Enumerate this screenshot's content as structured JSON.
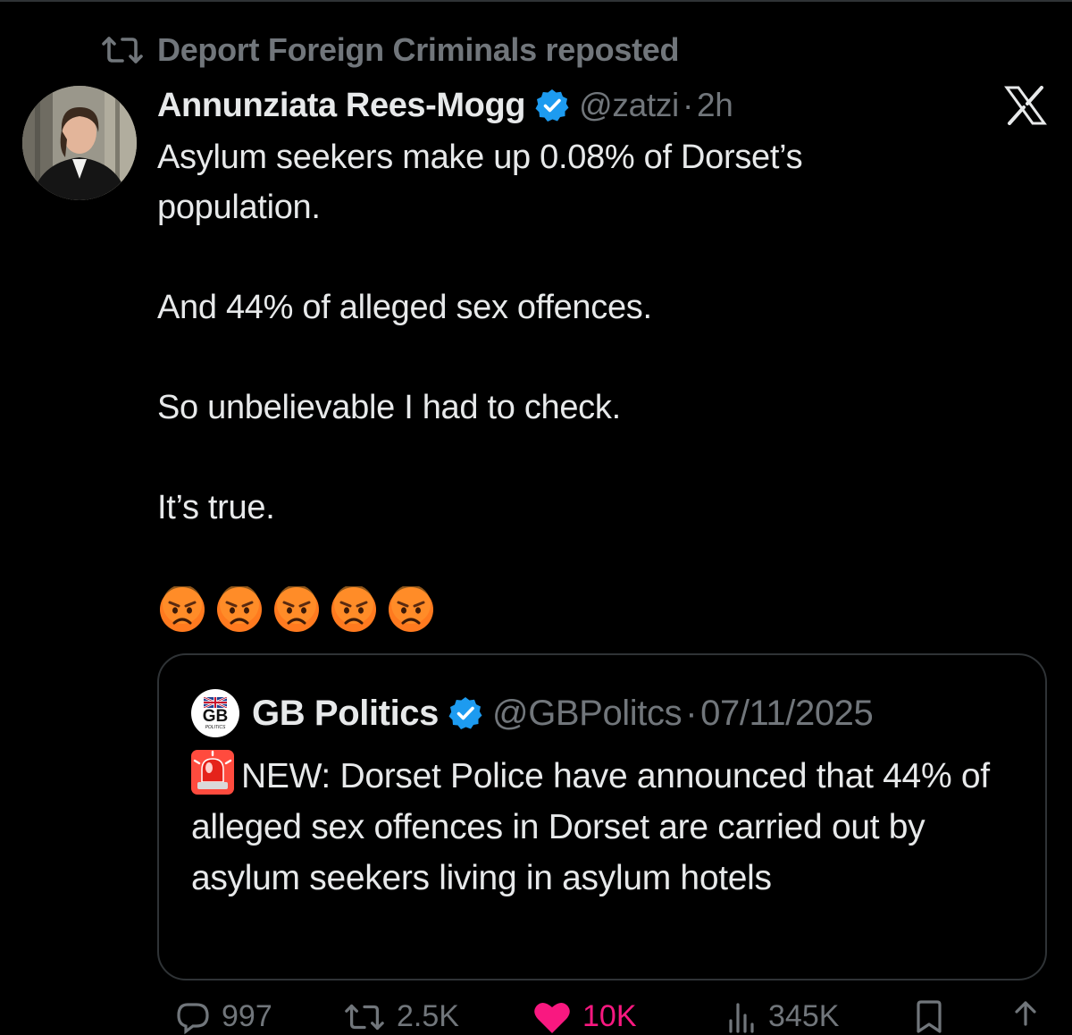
{
  "repost": {
    "icon": "repost-icon",
    "text": "Deport Foreign Criminals reposted"
  },
  "tweet": {
    "author": {
      "name": "Annunziata Rees-Mogg",
      "verified": true,
      "handle": "@zatzi",
      "separator": "·",
      "time": "2h"
    },
    "lines": [
      "Asylum seekers make up 0.08% of Dorset’s population.",
      "And 44% of alleged sex offences.",
      "So unbelievable I had to check.",
      "It’s true."
    ],
    "emojis": [
      "angry-face",
      "angry-face",
      "angry-face",
      "angry-face",
      "angry-face"
    ]
  },
  "quote": {
    "author": {
      "avatar_text": "GB",
      "avatar_subtext": "POLITICS",
      "name": "GB Politics",
      "verified": true,
      "handle": "@GBPolitcs",
      "separator": "·",
      "date": "07/11/2025"
    },
    "text": "NEW: Dorset Police have announced that 44% of alleged sex offences in Dorset are carried out by asylum seekers living in asylum hotels",
    "leading_emoji": "siren-icon"
  },
  "actions": [
    {
      "name": "reply",
      "icon": "reply-icon",
      "count": "997"
    },
    {
      "name": "repost",
      "icon": "repost-icon",
      "count": "2.5K"
    },
    {
      "name": "like",
      "icon": "heart-icon",
      "count": "10K"
    },
    {
      "name": "views",
      "icon": "views-icon",
      "count": "345K"
    },
    {
      "name": "bookmark",
      "icon": "bookmark-icon",
      "count": ""
    },
    {
      "name": "share",
      "icon": "share-icon",
      "count": ""
    }
  ],
  "colors": {
    "background": "#000000",
    "text": "#e7e9ea",
    "muted": "#71767b",
    "border": "#2f3336",
    "verified": "#1d9bf0",
    "like": "#f91880"
  }
}
